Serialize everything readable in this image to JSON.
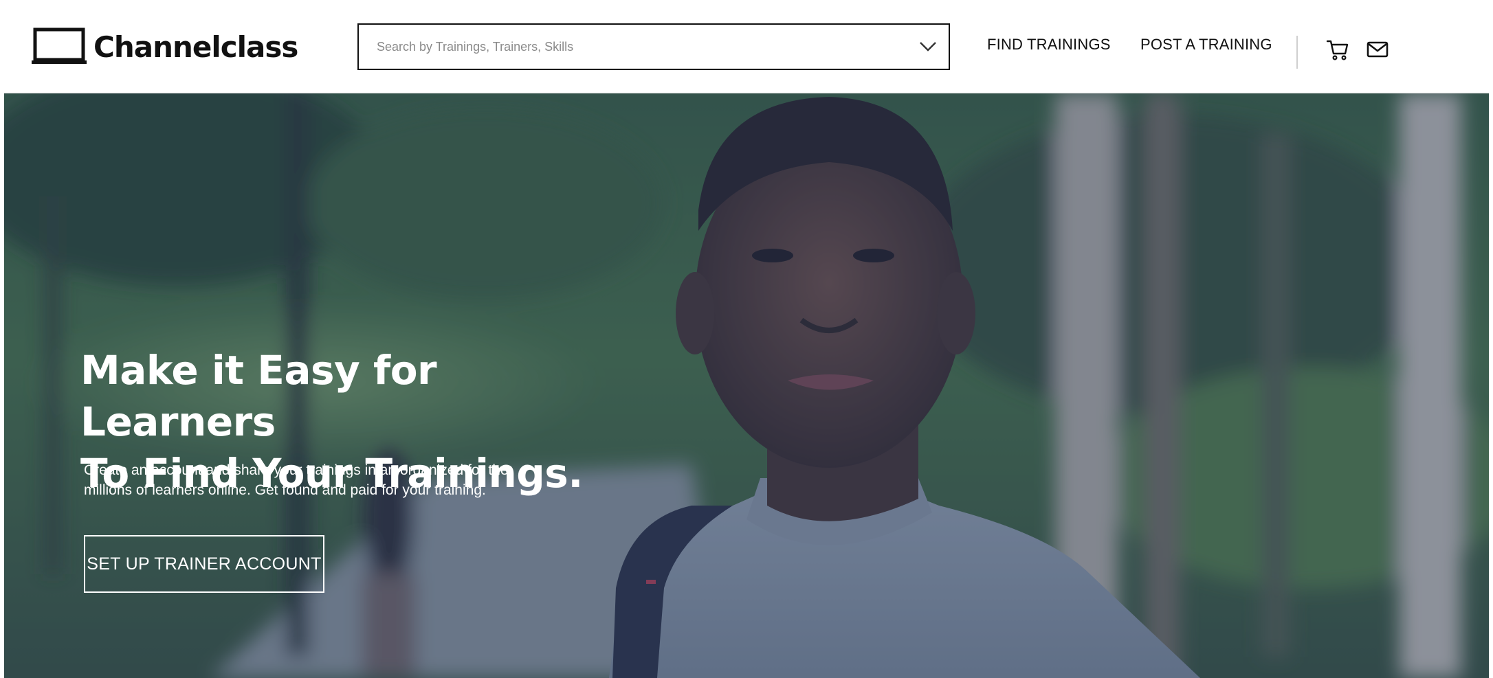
{
  "header": {
    "logo_text": "Channelclass",
    "logo_icon": "laptop-icon",
    "search": {
      "placeholder": "Search by Trainings, Trainers, Skills",
      "value": "",
      "dropdown_icon": "chevron-down-icon"
    },
    "nav": {
      "find_trainings": "FIND TRAININGS",
      "post_training": "POST A TRAINING"
    },
    "cart_icon": "cart-icon",
    "mail_icon": "mail-icon"
  },
  "hero": {
    "title_line1": "Make it Easy for Learners",
    "title_line2": "To Find Your Trainings.",
    "subtitle_line1": "Create an account and share your trainings in an organized for the",
    "subtitle_line2": "millions of learners online. Get found and paid for your training.",
    "cta_label": "SET UP TRAINER ACCOUNT",
    "overlay_color": "#3a4a78"
  }
}
